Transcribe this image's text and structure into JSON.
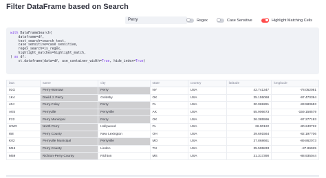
{
  "page": {
    "title": "Filter DataFrame based on Search"
  },
  "search": {
    "value": "Perry"
  },
  "toggles": [
    {
      "label": "Regex",
      "on": false
    },
    {
      "label": "Case Sensitive",
      "on": false
    },
    {
      "label": "Highlight Matching Cells",
      "on": true
    }
  ],
  "code": [
    "with DataFrameSearch(",
    "    dataframe=df,",
    "    text_search=search_text,",
    "    case_sensitive=case_sensitive,",
    "    regex_search=is_regex,",
    "    highlight_matches=highlight_match,",
    ") as df:",
    "    st.dataframe(data=df, use_container_width=True, hide_index=True)"
  ],
  "table": {
    "columns": [
      "iata",
      "name",
      "city",
      "state",
      "country",
      "latitude",
      "longitude"
    ],
    "rows": [
      {
        "cells": [
          "01G",
          "Perry-Warsaw",
          "Perry",
          "NY",
          "USA",
          "42.741347",
          "-78.052081"
        ],
        "hl": [
          1,
          2
        ]
      },
      {
        "cells": [
          "1K4",
          "David J. Perry",
          "Goldsby",
          "OK",
          "USA",
          "35.155068",
          "-97.470394"
        ],
        "hl": [
          1
        ]
      },
      {
        "cells": [
          "40J",
          "Perry-Foley",
          "Perry",
          "FL",
          "USA",
          "30.069281",
          "-83.580653"
        ],
        "hl": [
          1,
          2
        ]
      },
      {
        "cells": [
          "AK5",
          "Perryville",
          "Perryville",
          "AK",
          "USA",
          "55.906673",
          "-159.158579"
        ],
        "hl": [
          1,
          2
        ]
      },
      {
        "cells": [
          "F22",
          "Perry Municipal",
          "Perry",
          "OK",
          "USA",
          "36.385596",
          "-97.277193"
        ],
        "hl": [
          1,
          2
        ]
      },
      {
        "cells": [
          "HWO",
          "North Perry",
          "Hollywood",
          "FL",
          "USA",
          "26.00122",
          "-80.240722"
        ],
        "hl": [
          1
        ]
      },
      {
        "cells": [
          "I68",
          "Perry County",
          "New Lexington",
          "OH",
          "USA",
          "39.691564",
          "-82.197706"
        ],
        "hl": [
          1
        ]
      },
      {
        "cells": [
          "K02",
          "Perryville Municipal",
          "Perryville",
          "MO",
          "USA",
          "37.868661",
          "-89.862073"
        ],
        "hl": [
          1,
          2
        ]
      },
      {
        "cells": [
          "M15",
          "Perry County",
          "Linden",
          "TN",
          "USA",
          "35.595833",
          "-87.86925"
        ],
        "hl": [
          1
        ]
      },
      {
        "cells": [
          "M59",
          "Richton-Perry County",
          "Richton",
          "MS",
          "USA",
          "31.317390",
          "-88.935044"
        ],
        "hl": [
          1
        ]
      }
    ]
  }
}
